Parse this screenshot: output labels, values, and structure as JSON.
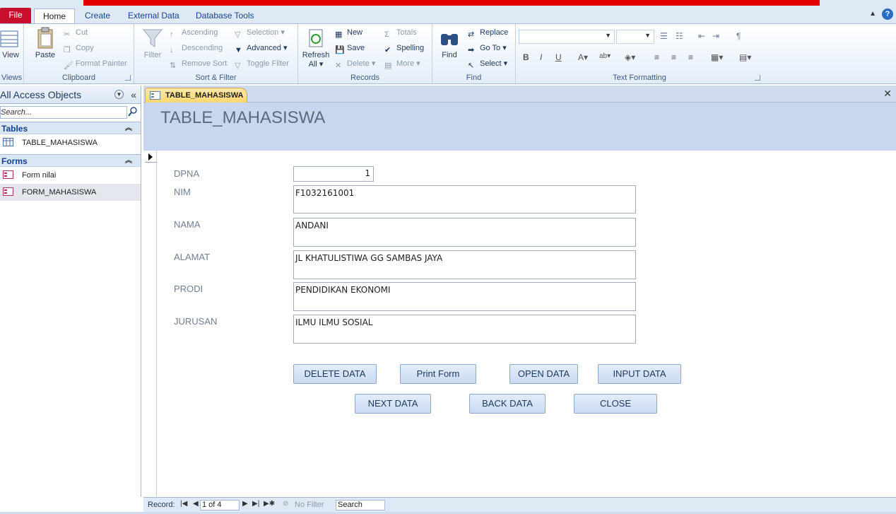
{
  "ribbon_tabs": [
    "File",
    "Home",
    "Create",
    "External Data",
    "Database Tools"
  ],
  "ribbon": {
    "views": {
      "label": "Views",
      "view": "View"
    },
    "clipboard": {
      "label": "Clipboard",
      "paste": "Paste",
      "cut": "Cut",
      "copy": "Copy",
      "format_painter": "Format Painter"
    },
    "sort_filter": {
      "label": "Sort & Filter",
      "filter": "Filter",
      "ascending": "Ascending",
      "descending": "Descending",
      "remove_sort": "Remove Sort",
      "selection": "Selection",
      "advanced": "Advanced",
      "toggle_filter": "Toggle Filter"
    },
    "records": {
      "label": "Records",
      "refresh": "Refresh",
      "refresh_all": "All",
      "new": "New",
      "save": "Save",
      "delete": "Delete",
      "totals": "Totals",
      "spelling": "Spelling",
      "more": "More"
    },
    "find": {
      "label": "Find",
      "find": "Find",
      "replace": "Replace",
      "goto": "Go To",
      "select": "Select"
    },
    "text_formatting": {
      "label": "Text Formatting",
      "bold": "B",
      "italic": "I",
      "underline": "U"
    }
  },
  "nav": {
    "header": "All Access Objects",
    "search_placeholder": "Search...",
    "sections": [
      {
        "title": "Tables",
        "items": [
          "TABLE_MAHASISWA"
        ]
      },
      {
        "title": "Forms",
        "items": [
          "Form nilai",
          "FORM_MAHASISWA"
        ]
      }
    ]
  },
  "document": {
    "tab_title": "TABLE_MAHASISWA",
    "form_title": "TABLE_MAHASISWA",
    "fields": [
      {
        "label": "DPNA",
        "value": "1"
      },
      {
        "label": "NIM",
        "value": "F1032161001"
      },
      {
        "label": "NAMA",
        "value": "ANDANI"
      },
      {
        "label": "ALAMAT",
        "value": "JL KHATULISTIWA GG SAMBAS JAYA"
      },
      {
        "label": "PRODI",
        "value": "PENDIDIKAN EKONOMI"
      },
      {
        "label": "JURUSAN",
        "value": "ILMU ILMU SOSIAL"
      }
    ],
    "buttons": [
      "DELETE DATA",
      "Print Form",
      "OPEN DATA",
      "INPUT DATA",
      "NEXT DATA",
      "BACK DATA",
      "CLOSE"
    ]
  },
  "record_nav": {
    "label": "Record:",
    "position": "1 of 4",
    "filter": "No Filter",
    "search": "Search"
  },
  "colors": {
    "file_tab": "#c8102e",
    "title_bar": "#e50000",
    "form_header": "#c6d7ef",
    "doc_tab": "#ffd76e"
  }
}
